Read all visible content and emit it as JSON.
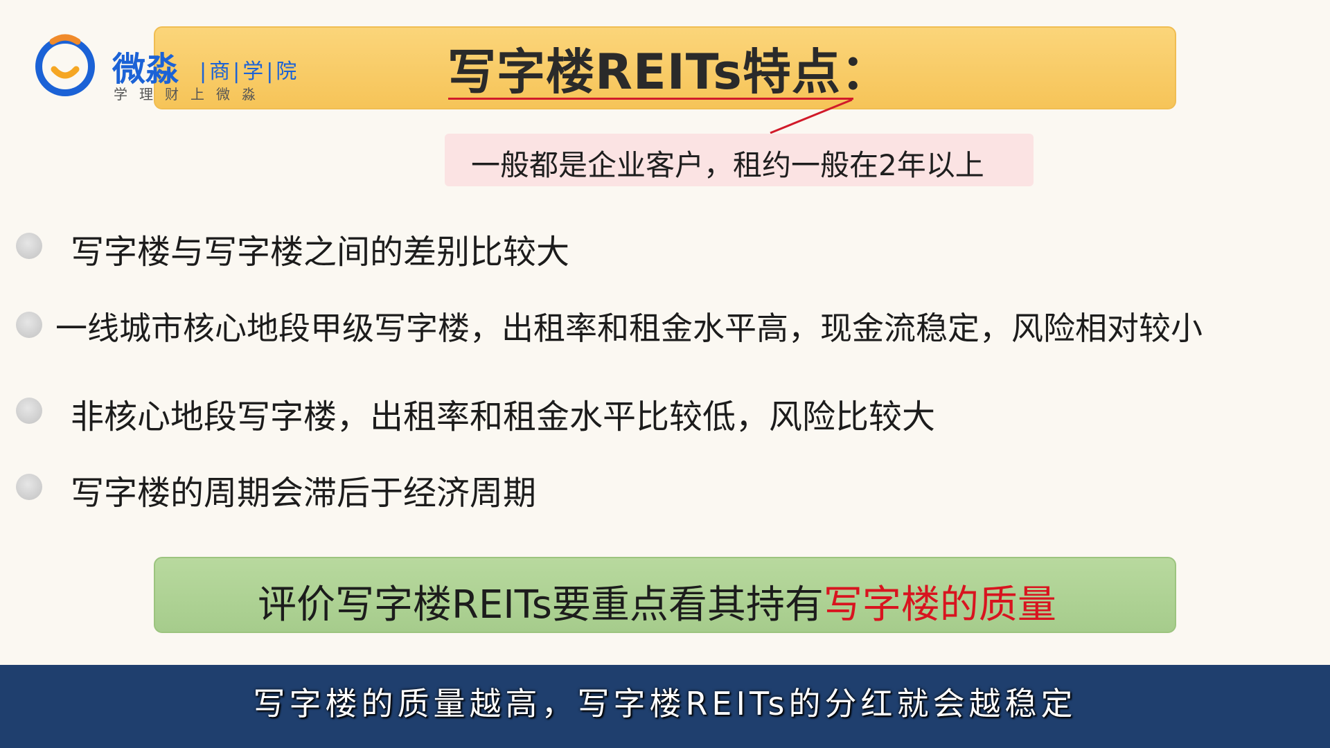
{
  "logo": {
    "main": "微淼",
    "sub_line1": "|商|学|院",
    "sub_line2": "学理财上微淼"
  },
  "title": "写字楼REITs特点：",
  "callout": "一般都是企业客户，租约一般在2年以上",
  "bullets": [
    "写字楼与写字楼之间的差别比较大",
    "一线城市核心地段甲级写字楼，出租率和租金水平高，现金流稳定，风险相对较小",
    "非核心地段写字楼，出租率和租金水平比较低，风险比较大",
    "写字楼的周期会滞后于经济周期"
  ],
  "summary": {
    "prefix": "评价写字楼REITs要重点看其持有",
    "highlight": "写字楼的质量"
  },
  "subtitle": "写字楼的质量越高，写字楼REITs的分红就会越稳定",
  "colors": {
    "title_banner": "#f6c458",
    "highlight_red": "#d8141f",
    "subtitle_bar": "#1f3f6e",
    "logo_blue": "#1b62d6",
    "logo_orange": "#f08a2a"
  }
}
